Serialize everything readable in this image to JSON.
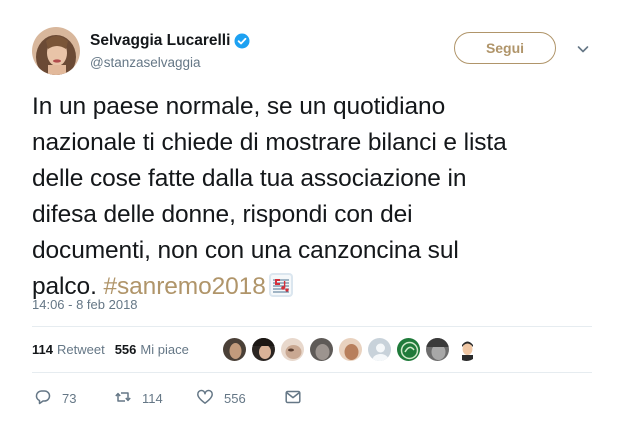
{
  "user": {
    "display_name": "Selvaggia Lucarelli",
    "handle": "@stanzaselvaggia",
    "verified": true
  },
  "follow_button": {
    "label": "Segui"
  },
  "tweet": {
    "lines": [
      "In un paese normale, se un quotidiano",
      "nazionale ti chiede di mostrare bilanci e lista",
      "delle cose fatte dalla tua associazione in",
      "difesa delle donne, rispondi con dei",
      "documenti, non con una canzoncina sul"
    ],
    "last_line_text": "palco. ",
    "hashtag": "#sanremo2018",
    "emoji": "musical-score-icon"
  },
  "timestamp": "14:06 - 8 feb 2018",
  "stats": {
    "retweets": {
      "count": "114",
      "label": "Retweet"
    },
    "likes": {
      "count": "556",
      "label": "Mi piace"
    }
  },
  "likers_count": 9,
  "actions": {
    "reply": {
      "count": "73"
    },
    "retweet": {
      "count": "114"
    },
    "like": {
      "count": "556"
    },
    "message": {
      "icon": "envelope-icon"
    }
  },
  "colors": {
    "accent": "#b0956a",
    "muted": "#657786",
    "text": "#14171a",
    "verified": "#1da1f2",
    "divider": "#e6ecf0"
  }
}
